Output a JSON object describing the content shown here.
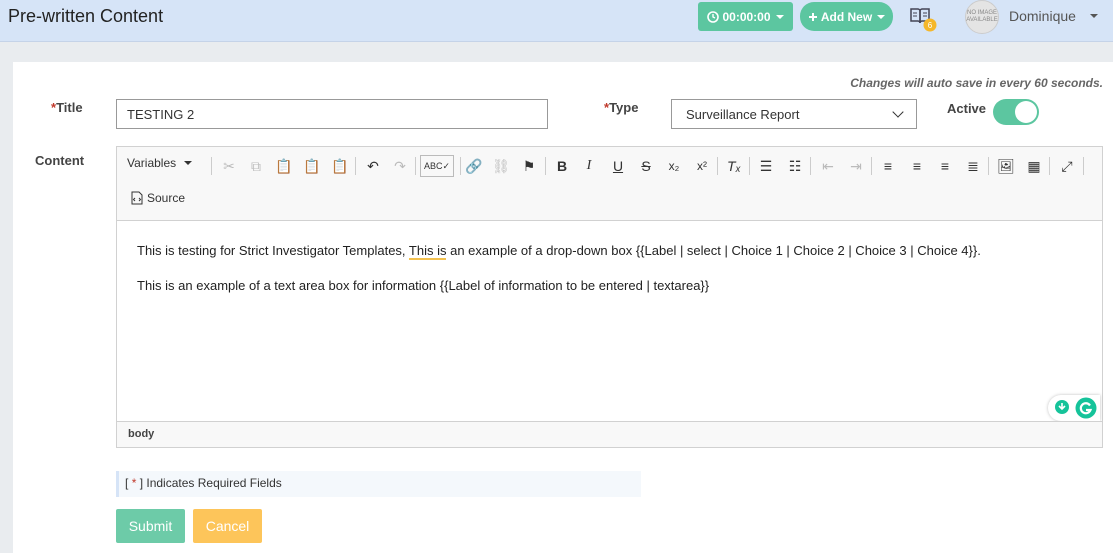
{
  "header": {
    "title": "Pre-written Content",
    "timer_label": "00:00:00",
    "add_new_label": "Add New",
    "notification_count": "6",
    "avatar_text": "NO IMAGE AVAILABLE",
    "user_name": "Dominique"
  },
  "form": {
    "autosave_note": "Changes will auto save in every 60 seconds.",
    "title_label": "Title",
    "title_value": "TESTING 2",
    "type_label": "Type",
    "type_value": "Surveillance Report",
    "active_label": "Active",
    "active_on": true,
    "content_label": "Content",
    "required_star": "*"
  },
  "editor": {
    "variables_label": "Variables",
    "source_label": "Source",
    "paragraph_1_a": "This is testing for Strict Investigator Templates,",
    "paragraph_1_b": "This is",
    "paragraph_1_c": "an example of a drop-down box {{Label | select | Choice 1 | Choice 2 | Choice 3 | Choice 4}}.",
    "paragraph_2": "This is an example of a text area box for information {{Label of information to be entered | textarea}}",
    "status_path": "body"
  },
  "footer": {
    "required_note_open": "[",
    "required_note_star": "*",
    "required_note_text": "] Indicates Required Fields",
    "submit_label": "Submit",
    "cancel_label": "Cancel"
  },
  "colors": {
    "accent_green": "#5cc6a0",
    "header_bg": "#d6e4f7",
    "cancel_yellow": "#fdc55a",
    "required_red": "#c0392b"
  }
}
